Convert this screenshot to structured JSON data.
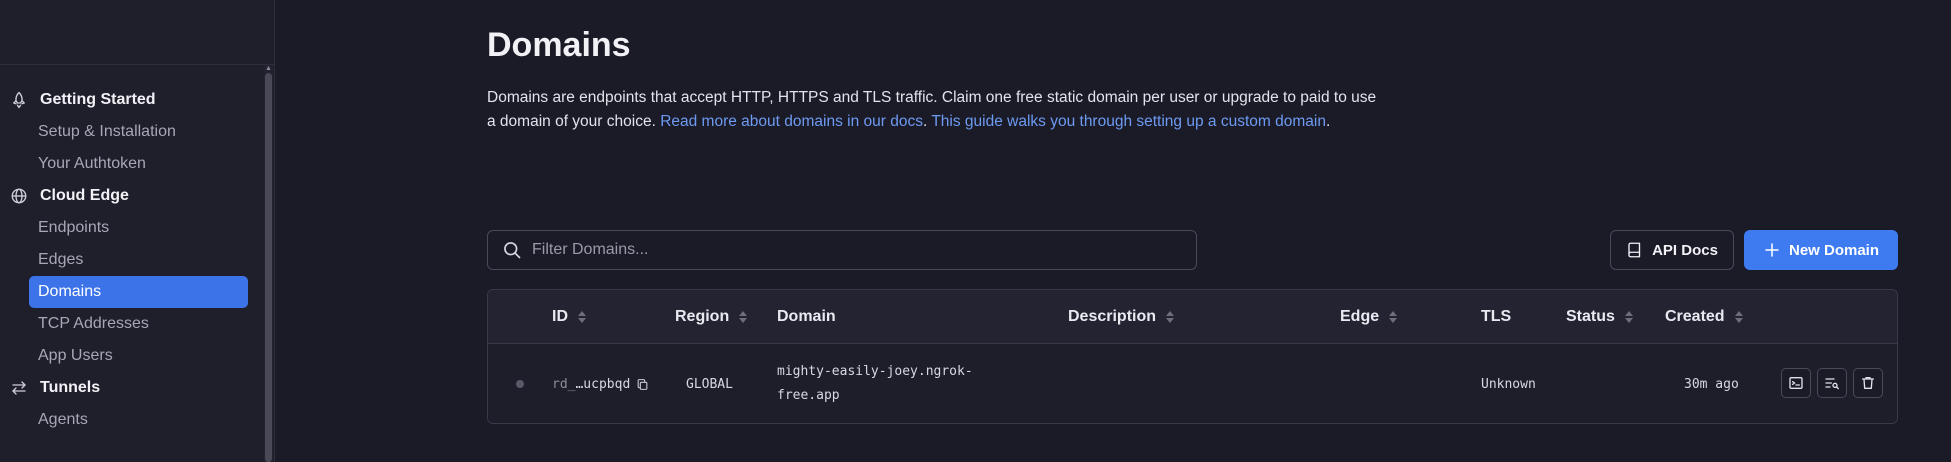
{
  "sidebar": {
    "sections": [
      {
        "label": "Getting Started",
        "icon": "rocket-icon",
        "items": [
          {
            "label": "Setup & Installation"
          },
          {
            "label": "Your Authtoken"
          }
        ]
      },
      {
        "label": "Cloud Edge",
        "icon": "globe-icon",
        "items": [
          {
            "label": "Endpoints"
          },
          {
            "label": "Edges"
          },
          {
            "label": "Domains",
            "active": true
          },
          {
            "label": "TCP Addresses"
          },
          {
            "label": "App Users"
          }
        ]
      },
      {
        "label": "Tunnels",
        "icon": "arrows-icon",
        "items": [
          {
            "label": "Agents"
          }
        ]
      }
    ]
  },
  "page": {
    "title": "Domains",
    "description_text": "Domains are endpoints that accept HTTP, HTTPS and TLS traffic. Claim one free static domain per user or upgrade to paid to use a domain of your choice. ",
    "link_docs": "Read more about domains in our docs",
    "separator": ". ",
    "link_guide": "This guide walks you through setting up a custom domain",
    "end": "."
  },
  "search": {
    "placeholder": "Filter Domains..."
  },
  "buttons": {
    "api_docs": "API Docs",
    "new_domain": "New Domain"
  },
  "table": {
    "columns": {
      "id": "ID",
      "region": "Region",
      "domain": "Domain",
      "description": "Description",
      "edge": "Edge",
      "tls": "TLS",
      "status": "Status",
      "created": "Created"
    },
    "rows": [
      {
        "id_prefix": "rd_",
        "id_suffix": "…ucpbqd",
        "region": "GLOBAL",
        "domain_line1": "mighty-easily-joey.ngrok-",
        "domain_line2": "free.app",
        "description": "",
        "edge": "",
        "tls": "Unknown",
        "status": "",
        "created": "30m ago"
      }
    ]
  },
  "colors": {
    "accent": "#3e7bf0",
    "active_nav": "#3c73e9",
    "link": "#6d9bf2"
  }
}
